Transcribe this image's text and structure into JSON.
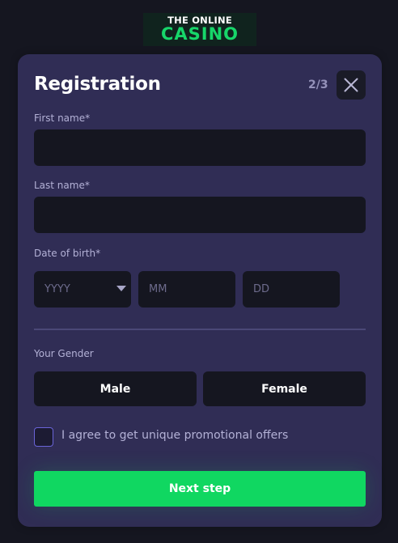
{
  "logo": {
    "top_text": "THE ONLINE",
    "bottom_text": "CASINO"
  },
  "form": {
    "title": "Registration",
    "step": "2/3",
    "first_name_label": "First name*",
    "first_name_value": "",
    "last_name_label": "Last name*",
    "last_name_value": "",
    "dob_label": "Date of birth*",
    "dob_year_placeholder": "YYYY",
    "dob_month_placeholder": "MM",
    "dob_day_placeholder": "DD",
    "gender_label": "Your Gender",
    "gender_male": "Male",
    "gender_female": "Female",
    "consent_text": "I agree to get unique promotional offers",
    "consent_checked": false,
    "next_label": "Next step"
  },
  "colors": {
    "accent": "#10d761",
    "card_background": "#302d55",
    "page_background": "#151620",
    "input_background": "#151620",
    "label_text": "#b3b1d6"
  },
  "icons": {
    "close": "close-icon",
    "dropdown": "chevron-down-icon"
  }
}
